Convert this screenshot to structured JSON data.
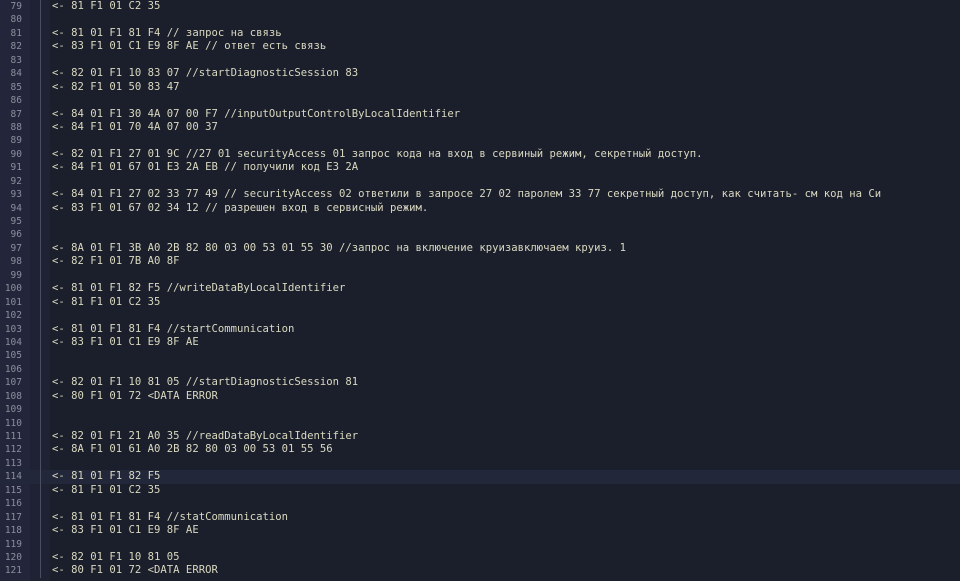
{
  "editor": {
    "current_line": "114",
    "lines": [
      {
        "n": "79",
        "code": "<- 81 F1 01 C2 35"
      },
      {
        "n": "80",
        "code": ""
      },
      {
        "n": "81",
        "code": "<- 81 01 F1 81 F4 // запрос на связь"
      },
      {
        "n": "82",
        "code": "<- 83 F1 01 C1 E9 8F AE // ответ есть связь"
      },
      {
        "n": "83",
        "code": ""
      },
      {
        "n": "84",
        "code": "<- 82 01 F1 10 83 07 //startDiagnosticSession 83"
      },
      {
        "n": "85",
        "code": "<- 82 F1 01 50 83 47"
      },
      {
        "n": "86",
        "code": ""
      },
      {
        "n": "87",
        "code": "<- 84 01 F1 30 4A 07 00 F7 //inputOutputControlByLocalIdentifier"
      },
      {
        "n": "88",
        "code": "<- 84 F1 01 70 4A 07 00 37"
      },
      {
        "n": "89",
        "code": ""
      },
      {
        "n": "90",
        "code": "<- 82 01 F1 27 01 9C //27 01 securityAccess 01 запрос кода на вход в сервиный режим, секретный доступ."
      },
      {
        "n": "91",
        "code": "<- 84 F1 01 67 01 E3 2A EB // получили код E3 2A"
      },
      {
        "n": "92",
        "code": ""
      },
      {
        "n": "93",
        "code": "<- 84 01 F1 27 02 33 77 49 // securityAccess 02  ответили в запросе 27 02 паролем 33 77 секретный доступ, как считать- см код на Си"
      },
      {
        "n": "94",
        "code": "<- 83 F1 01 67 02 34 12 // разрешен вход в сервисный режим."
      },
      {
        "n": "95",
        "code": ""
      },
      {
        "n": "96",
        "code": ""
      },
      {
        "n": "97",
        "code": "<- 8A 01 F1 3B A0 2B 82 80 03 00 53 01 55 30 //запрос на включение круизавключаем круиз. 1"
      },
      {
        "n": "98",
        "code": "<- 82 F1 01 7B A0 8F"
      },
      {
        "n": "99",
        "code": ""
      },
      {
        "n": "100",
        "code": "<- 81 01 F1 82 F5 //writeDataByLocalIdentifier"
      },
      {
        "n": "101",
        "code": "<- 81 F1 01 C2 35"
      },
      {
        "n": "102",
        "code": ""
      },
      {
        "n": "103",
        "code": "<- 81 01 F1 81 F4 //startCommunication"
      },
      {
        "n": "104",
        "code": "<- 83 F1 01 C1 E9 8F AE"
      },
      {
        "n": "105",
        "code": ""
      },
      {
        "n": "106",
        "code": ""
      },
      {
        "n": "107",
        "code": "<- 82 01 F1 10 81 05 //startDiagnosticSession 81"
      },
      {
        "n": "108",
        "code": "<- 80 F1 01 72 <DATA ERROR"
      },
      {
        "n": "109",
        "code": ""
      },
      {
        "n": "110",
        "code": ""
      },
      {
        "n": "111",
        "code": "<- 82 01 F1 21 A0 35 //readDataByLocalIdentifier"
      },
      {
        "n": "112",
        "code": "<- 8A F1 01 61 A0 2B 82 80 03 00 53 01 55 56"
      },
      {
        "n": "113",
        "code": ""
      },
      {
        "n": "114",
        "code": "<- 81 01 F1 82 F5"
      },
      {
        "n": "115",
        "code": "<- 81 F1 01 C2 35"
      },
      {
        "n": "116",
        "code": ""
      },
      {
        "n": "117",
        "code": "<- 81 01 F1 81 F4 //statCommunication"
      },
      {
        "n": "118",
        "code": "<- 83 F1 01 C1 E9 8F AE"
      },
      {
        "n": "119",
        "code": ""
      },
      {
        "n": "120",
        "code": "<- 82 01 F1 10 81 05"
      },
      {
        "n": "121",
        "code": "<- 80 F1 01 72 <DATA ERROR"
      }
    ]
  }
}
